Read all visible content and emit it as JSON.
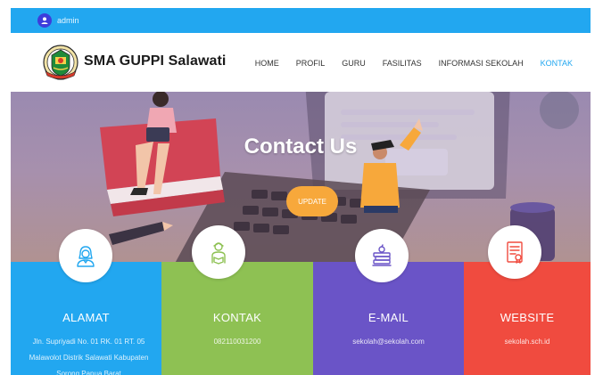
{
  "topbar": {
    "user": "admin"
  },
  "navbar": {
    "brand": "SMA GUPPI Salawati",
    "items": [
      {
        "label": "HOME",
        "active": false
      },
      {
        "label": "PROFIL",
        "active": false
      },
      {
        "label": "GURU",
        "active": false
      },
      {
        "label": "FASILITAS",
        "active": false
      },
      {
        "label": "INFORMASI SEKOLAH",
        "active": false
      },
      {
        "label": "KONTAK",
        "active": true
      }
    ]
  },
  "hero": {
    "title": "Contact Us",
    "button": "UPDATE"
  },
  "cards": [
    {
      "title": "ALAMAT",
      "text": "Jln. Supriyadi No. 01 RK. 01 RT. 05 Malawolot Distrik Salawati Kabupaten Sorong Papua Barat",
      "color": "#22a7f0",
      "icon": "woman-avatar-icon"
    },
    {
      "title": "KONTAK",
      "text": "082110031200",
      "color": "#8ec153",
      "icon": "student-reading-icon"
    },
    {
      "title": "E-MAIL",
      "text": "sekolah@sekolah.com",
      "color": "#6a54c7",
      "icon": "books-apple-icon"
    },
    {
      "title": "WEBSITE",
      "text": "sekolah.sch.id",
      "color": "#f04b3f",
      "icon": "certificate-icon"
    }
  ],
  "colors": {
    "accent": "#22a7f0",
    "button": "#f7a83b"
  }
}
